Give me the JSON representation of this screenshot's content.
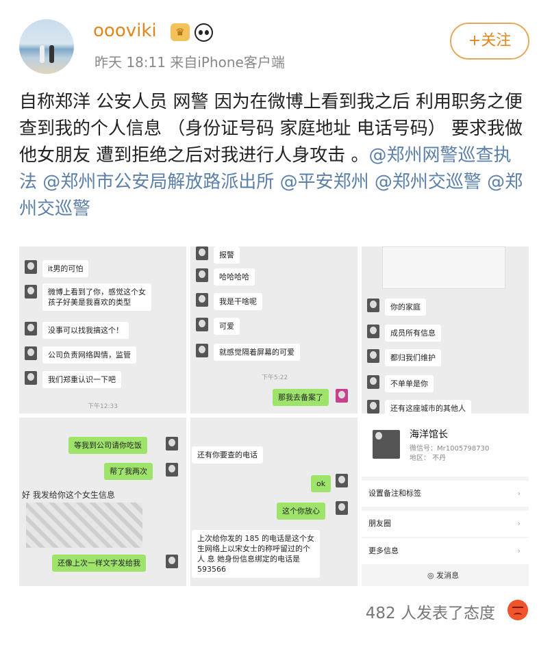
{
  "header": {
    "username": "oooviki",
    "meta": "昨天 18:11  来自iPhone客户端",
    "follow_label": "+关注",
    "badge_icon": "crown-icon",
    "emoji_icon": "panda-icon"
  },
  "post": {
    "text": "自称郑洋 公安人员 网警 因为在微博上看到我之后 利用职务之便 查到我的个人信息 （身份证号码 家庭地址 电话号码） 要求我做他女朋友 遭到拒绝之后对我进行人身攻击 。",
    "mentions": [
      "@郑州网警巡查执法",
      "@郑州市公安局解放路派出所",
      "@平安郑州",
      "@郑州交巡警",
      "@郑州交巡警"
    ]
  },
  "shots": {
    "s1": [
      "it男的可怕",
      "微博上看到了你，感觉这个女",
      "孩子好美是我喜欢的类型",
      "没事可以找我搞这个！",
      "公司负责网络舆情，监管",
      "我们郑重认识一下吧",
      "下午12:33"
    ],
    "s2": [
      "报警",
      "哈哈哈哈",
      "我是干啥呢",
      "可爱",
      "就感觉隔着屏幕的可爱",
      "下午5:22",
      "那我去备案了"
    ],
    "s3": [
      "你的家庭",
      "成员所有信息",
      "都归我们维护",
      "不单单是你",
      "还有这座城市的其他人"
    ],
    "s4": [
      "等我到公司请你吃饭",
      "帮了我两次",
      "好 我发给你这个女生信息",
      "还像上次一样文字发给我"
    ],
    "s5": [
      "还有你要查的电话",
      "ok",
      "这个你放心",
      "上次给你发的 185 的电话是这个女",
      "生网络上以宋女士的称呼留过的个",
      "人   息 她身份信息绑定的电话是",
      "593566"
    ],
    "s6": {
      "name": "海洋馆长",
      "wechat_id": "微信号：Mr1005798730",
      "region": "地区：  不丹",
      "rows": [
        "设置备注和标签",
        "朋友圈",
        "更多信息"
      ],
      "send": "发消息"
    }
  },
  "footer": {
    "reactions": "482 人发表了态度",
    "reaction_icon": "angry-face-icon"
  }
}
